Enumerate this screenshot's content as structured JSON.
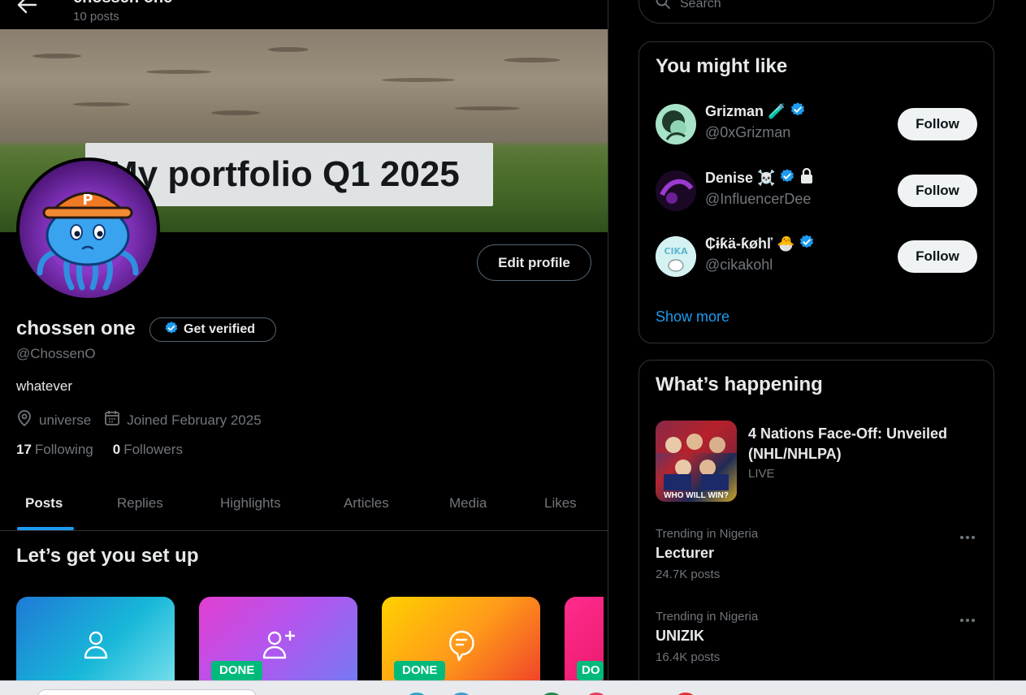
{
  "header": {
    "title": "chossen one",
    "post_count": "10 posts"
  },
  "banner": {
    "caption": "My portfolio Q1 2025"
  },
  "profile": {
    "edit_label": "Edit profile",
    "display_name": "chossen one",
    "get_verified_label": "Get verified",
    "handle": "@ChossenO",
    "bio": "whatever",
    "location": "universe",
    "joined": "Joined February 2025",
    "following_count": "17",
    "following_label": "Following",
    "followers_count": "0",
    "followers_label": "Followers"
  },
  "tabs": [
    {
      "label": "Posts",
      "active": true
    },
    {
      "label": "Replies",
      "active": false
    },
    {
      "label": "Highlights",
      "active": false
    },
    {
      "label": "Articles",
      "active": false
    },
    {
      "label": "Media",
      "active": false
    },
    {
      "label": "Likes",
      "active": false
    }
  ],
  "setup": {
    "title": "Let’s get you set up",
    "cards": [
      {
        "icon": "person-icon",
        "done": false
      },
      {
        "icon": "person-add-icon",
        "done": true,
        "done_label": "DONE"
      },
      {
        "icon": "chat-bubble-icon",
        "done": true,
        "done_label": "DONE"
      },
      {
        "icon": "card-icon",
        "done": true,
        "done_label": "DO"
      }
    ]
  },
  "search": {
    "placeholder": "Search"
  },
  "you_might_like": {
    "title": "You might like",
    "users": [
      {
        "name": "Grizman",
        "emoji": "🧪",
        "handle": "@0xGrizman",
        "verified": true,
        "locked": false,
        "follow_label": "Follow"
      },
      {
        "name": "Denise",
        "emoji": "☠️",
        "handle": "@InfluencerDee",
        "verified": true,
        "locked": true,
        "follow_label": "Follow"
      },
      {
        "name": "₵ɨƙä-ƙøhľ",
        "emoji": "🐣",
        "handle": "@cikakohl",
        "verified": true,
        "locked": false,
        "follow_label": "Follow"
      }
    ],
    "show_more": "Show more"
  },
  "whats_happening": {
    "title": "What’s happening",
    "news": {
      "title": "4 Nations Face-Off: Unveiled (NHL/NHLPA)",
      "status": "LIVE",
      "image_caption": "WHO WILL WIN?"
    },
    "trends": [
      {
        "context": "Trending in Nigeria",
        "name": "Lecturer",
        "count": "24.7K posts"
      },
      {
        "context": "Trending in Nigeria",
        "name": "UNIZIK",
        "count": "16.4K posts"
      }
    ]
  },
  "colors": {
    "background": "#000000",
    "accent": "#1d9bf0",
    "verified": "#1d9bf0",
    "done_badge": "#00ba7c",
    "muted_text": "#71767b",
    "border": "#2f3336"
  }
}
